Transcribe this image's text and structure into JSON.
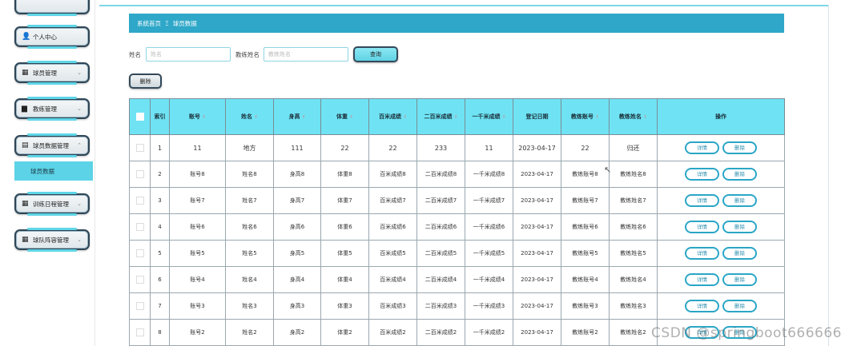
{
  "sidebar": {
    "items": [
      {
        "icon": "user-icon",
        "glyph": "👤",
        "label": "个人中心",
        "chevron": "⌄"
      },
      {
        "icon": "grid-icon",
        "glyph": "▦",
        "label": "球员管理",
        "chevron": "⌄"
      },
      {
        "icon": "briefcase-icon",
        "glyph": "▆",
        "label": "教练管理",
        "chevron": "⌄"
      },
      {
        "icon": "clipboard-icon",
        "glyph": "▤",
        "label": "球员数据管理",
        "chevron": "⌃"
      },
      {
        "icon": "grid-icon",
        "glyph": "▦",
        "label": "训练日程管理",
        "chevron": "⌄"
      },
      {
        "icon": "grid-icon",
        "glyph": "▦",
        "label": "球队阵容管理",
        "chevron": "⌄"
      }
    ],
    "active_sub": "球员数据"
  },
  "breadcrumb": {
    "home": "系统首页",
    "sep": "Ξ",
    "current": "球员数据"
  },
  "search": {
    "name_label": "姓名",
    "name_placeholder": "姓名",
    "coach_label": "教练姓名",
    "coach_placeholder": "教练姓名",
    "query_label": "查询"
  },
  "toolbar": {
    "delete_label": "删除"
  },
  "table": {
    "columns": [
      "",
      "索引",
      "账号",
      "姓名",
      "身高",
      "体重",
      "百米成绩",
      "二百米成绩",
      "一千米成绩",
      "登记日期",
      "教练账号",
      "教练姓名",
      "操作"
    ],
    "sortable": [
      false,
      false,
      true,
      true,
      true,
      true,
      true,
      true,
      true,
      false,
      true,
      true,
      false
    ],
    "sort_glyph": "⬍",
    "detail_label": "详情",
    "delete_label": "删除",
    "rows": [
      [
        "1",
        "11",
        "地方",
        "111",
        "22",
        "22",
        "233",
        "11",
        "2023-04-17",
        "22",
        "归还"
      ],
      [
        "2",
        "账号8",
        "姓名8",
        "身高8",
        "体重8",
        "百米成绩8",
        "二百米成绩8",
        "一千米成绩8",
        "2023-04-17",
        "教练账号8",
        "教练姓名8"
      ],
      [
        "3",
        "账号7",
        "姓名7",
        "身高7",
        "体重7",
        "百米成绩7",
        "二百米成绩7",
        "一千米成绩7",
        "2023-04-17",
        "教练账号7",
        "教练姓名7"
      ],
      [
        "4",
        "账号6",
        "姓名6",
        "身高6",
        "体重6",
        "百米成绩6",
        "二百米成绩6",
        "一千米成绩6",
        "2023-04-17",
        "教练账号6",
        "教练姓名6"
      ],
      [
        "5",
        "账号5",
        "姓名5",
        "身高5",
        "体重5",
        "百米成绩5",
        "二百米成绩5",
        "一千米成绩5",
        "2023-04-17",
        "教练账号5",
        "教练姓名5"
      ],
      [
        "6",
        "账号4",
        "姓名4",
        "身高4",
        "体重4",
        "百米成绩4",
        "二百米成绩4",
        "一千米成绩4",
        "2023-04-17",
        "教练账号4",
        "教练姓名4"
      ],
      [
        "7",
        "账号3",
        "姓名3",
        "身高3",
        "体重3",
        "百米成绩3",
        "二百米成绩3",
        "一千米成绩3",
        "2023-04-17",
        "教练账号3",
        "教练姓名3"
      ],
      [
        "8",
        "账号2",
        "姓名2",
        "身高2",
        "体重2",
        "百米成绩2",
        "二百米成绩2",
        "一千米成绩2",
        "2023-04-17",
        "教练账号2",
        "教练姓名2"
      ]
    ]
  },
  "watermark": "CSDN @springboot666666",
  "colors": {
    "accent": "#2ea7c8",
    "header_bg": "#6fe3f4",
    "active_menu": "#5cd3e6"
  }
}
